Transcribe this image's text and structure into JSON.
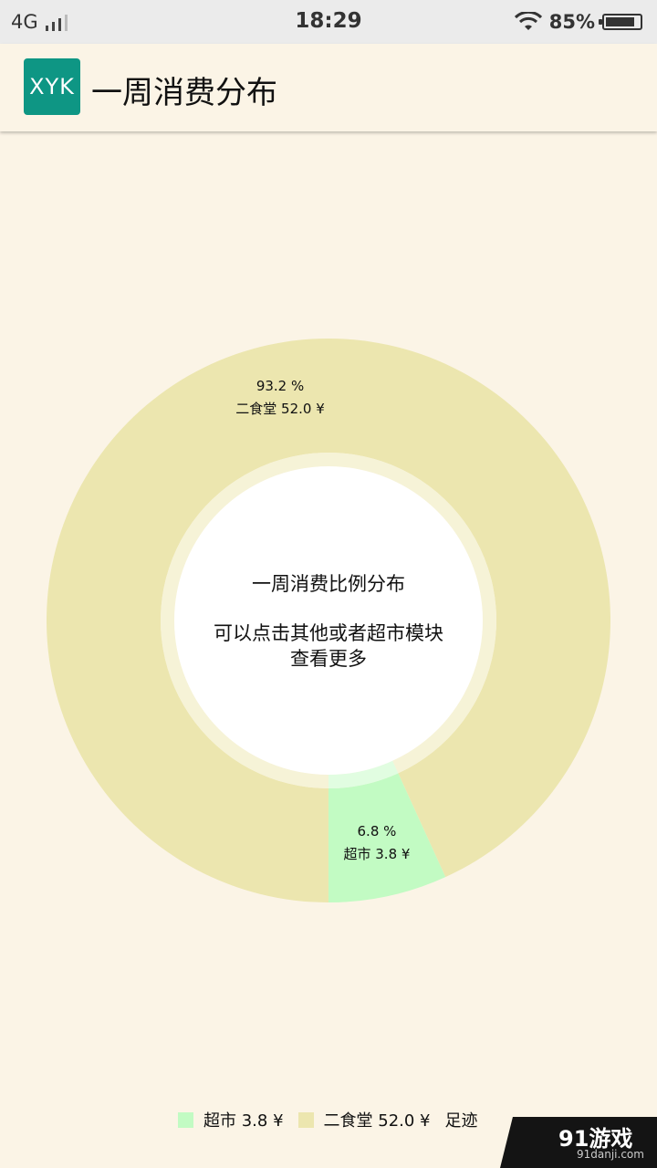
{
  "status_bar": {
    "network": "4G",
    "time": "18:29",
    "battery": "85%",
    "battery_level": 0.85
  },
  "app_bar": {
    "logo_text": "XYK",
    "title": "一周消费分布"
  },
  "chart_data": {
    "type": "pie",
    "style": "donut",
    "center_title": "一周消费比例分布",
    "center_subtitle": [
      "可以点击其他或者超市模块",
      "查看更多"
    ],
    "slices": [
      {
        "name": "二食堂",
        "value": 52.0,
        "percent": "93.2 %",
        "value_label": "二食堂 52.0 ¥",
        "color": "#ECE6AF"
      },
      {
        "name": "超市",
        "value": 3.8,
        "percent": "6.8 %",
        "value_label": "超市 3.8 ¥",
        "color": "#C2FBC3"
      }
    ],
    "legend": [
      {
        "label": "超市 3.8 ¥",
        "color": "#C2FBC3"
      },
      {
        "label": "二食堂 52.0 ¥",
        "color": "#ECE6AF"
      },
      {
        "label": "足迹"
      }
    ],
    "legend_position": "bottom-center"
  },
  "watermark": {
    "text": "91游戏",
    "subtext": "91danji.com"
  }
}
